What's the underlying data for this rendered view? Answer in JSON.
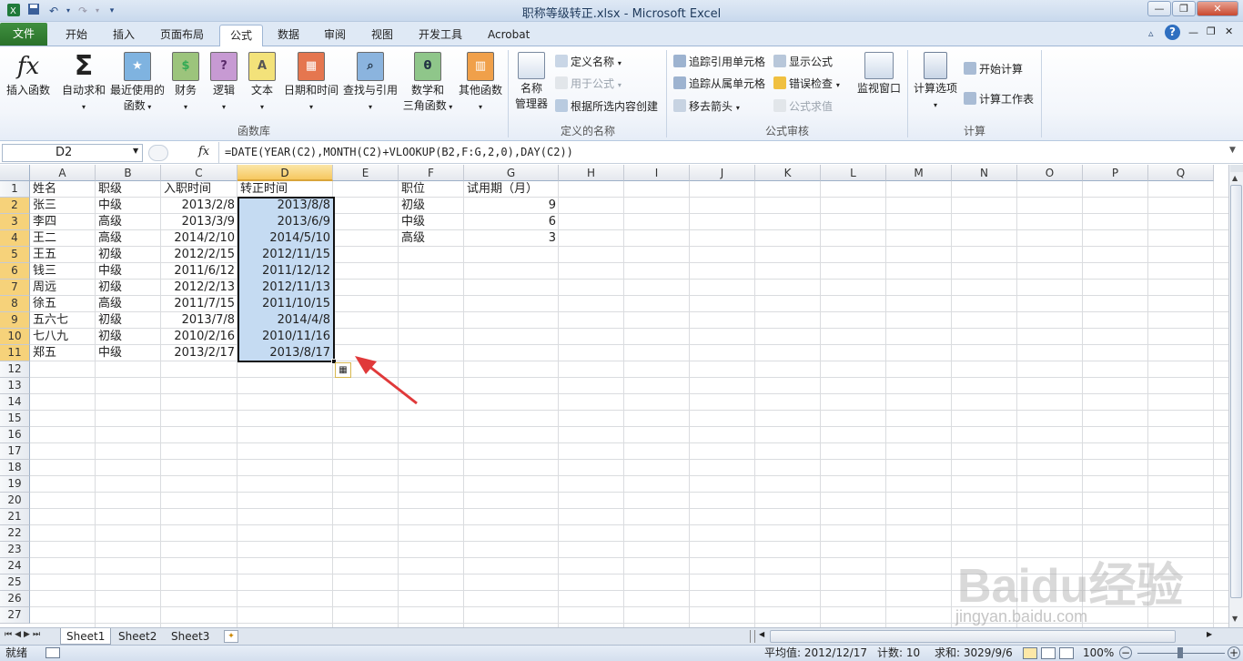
{
  "window": {
    "title": "职称等级转正.xlsx  -  Microsoft Excel"
  },
  "tabs": [
    "文件",
    "开始",
    "插入",
    "页面布局",
    "公式",
    "数据",
    "审阅",
    "视图",
    "开发工具",
    "Acrobat"
  ],
  "ribbon": {
    "insert_function": "插入函数",
    "autosum": "自动求和",
    "recent_line1": "最近使用的",
    "recent_line2": "函数",
    "financial": "财务",
    "logical": "逻辑",
    "text": "文本",
    "datetime": "日期和时间",
    "lookup": "查找与引用",
    "math_line1": "数学和",
    "math_line2": "三角函数",
    "other": "其他函数",
    "library_group": "函数库",
    "name_manager_line1": "名称",
    "name_manager_line2": "管理器",
    "define_name": "定义名称",
    "use_in_formula": "用于公式",
    "create_from_selection": "根据所选内容创建",
    "names_group": "定义的名称",
    "trace_precedents": "追踪引用单元格",
    "trace_dependents": "追踪从属单元格",
    "remove_arrows": "移去箭头",
    "show_formulas": "显示公式",
    "error_checking": "错误检查",
    "evaluate_formula": "公式求值",
    "watch_window": "监视窗口",
    "auditing_group": "公式审核",
    "calc_options": "计算选项",
    "calc_now": "开始计算",
    "calc_sheet": "计算工作表",
    "calc_group": "计算"
  },
  "formula_bar": {
    "name_box": "D2",
    "fx": "fx",
    "formula": "=DATE(YEAR(C2),MONTH(C2)+VLOOKUP(B2,F:G,2,0),DAY(C2))"
  },
  "columns": [
    "A",
    "B",
    "C",
    "D",
    "E",
    "F",
    "G",
    "H",
    "I",
    "J",
    "K",
    "L",
    "M",
    "N",
    "O",
    "P",
    "Q"
  ],
  "rows": [
    "1",
    "2",
    "3",
    "4",
    "5",
    "6",
    "7",
    "8",
    "9",
    "10",
    "11",
    "12",
    "13",
    "14",
    "15",
    "16",
    "17",
    "18",
    "19",
    "20",
    "21",
    "22",
    "23",
    "24",
    "25",
    "26",
    "27"
  ],
  "table": {
    "header": [
      "姓名",
      "职级",
      "入职时间",
      "转正时间"
    ],
    "data": [
      [
        "张三",
        "中级",
        "2013/2/8",
        "2013/8/8"
      ],
      [
        "李四",
        "高级",
        "2013/3/9",
        "2013/6/9"
      ],
      [
        "王二",
        "高级",
        "2014/2/10",
        "2014/5/10"
      ],
      [
        "王五",
        "初级",
        "2012/2/15",
        "2012/11/15"
      ],
      [
        "钱三",
        "中级",
        "2011/6/12",
        "2011/12/12"
      ],
      [
        "周远",
        "初级",
        "2012/2/13",
        "2012/11/13"
      ],
      [
        "徐五",
        "高级",
        "2011/7/15",
        "2011/10/15"
      ],
      [
        "五六七",
        "初级",
        "2013/7/8",
        "2014/4/8"
      ],
      [
        "七八九",
        "初级",
        "2010/2/16",
        "2010/11/16"
      ],
      [
        "郑五",
        "中级",
        "2013/2/17",
        "2013/8/17"
      ]
    ]
  },
  "lookup": {
    "header": [
      "职位",
      "试用期（月）"
    ],
    "rows": [
      [
        "初级",
        "9"
      ],
      [
        "中级",
        "6"
      ],
      [
        "高级",
        "3"
      ]
    ]
  },
  "sheets": [
    "Sheet1",
    "Sheet2",
    "Sheet3"
  ],
  "status": {
    "ready": "就绪",
    "average": "平均值: 2012/12/17",
    "count": "计数: 10",
    "sum": "求和: 3029/9/6",
    "zoom": "100%"
  },
  "watermark": {
    "brand": "Baidu经验",
    "url": "jingyan.baidu.com"
  },
  "colors": {
    "file_tab": "#2a722a",
    "selection_fill": "#c5dbf2",
    "arrow": "#e0393a"
  }
}
